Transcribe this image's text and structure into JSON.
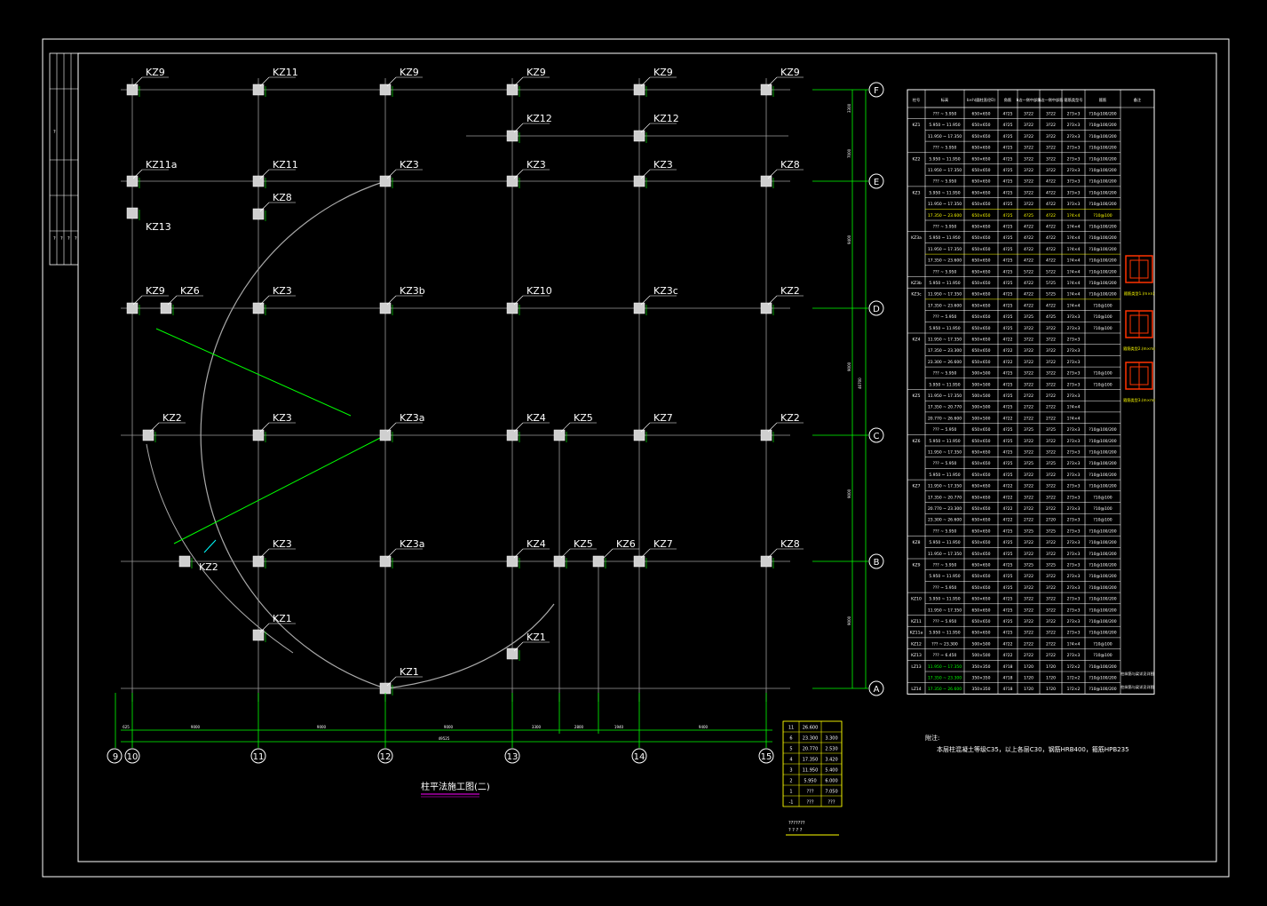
{
  "drawing": {
    "title": "柱平法施工图(二)",
    "notes_title": "附注:",
    "notes_text": "本层柱混凝土等级C35，以上各层C30，钢筋HRB400，箍筋HPB235",
    "bottom_total": "49525",
    "bottom_dims": [
      "625",
      "9000",
      "9000",
      "9000",
      "3300",
      "2800",
      "1940",
      "9400"
    ],
    "right_total": "46700",
    "right_dims": [
      "3300",
      "7000",
      "9400",
      "9000",
      "9000",
      "9000"
    ]
  },
  "grid": {
    "x_axes": [
      "9",
      "10",
      "11",
      "12",
      "13",
      "14",
      "15"
    ],
    "y_axes": [
      "F",
      "E",
      "D",
      "C",
      "B",
      "A"
    ]
  },
  "column_labels": [
    {
      "id": "r1c1",
      "text": "KZ9"
    },
    {
      "id": "r1c2",
      "text": "KZ11"
    },
    {
      "id": "r1c3",
      "text": "KZ9"
    },
    {
      "id": "r1c4",
      "text": "KZ9"
    },
    {
      "id": "r1c5",
      "text": "KZ9"
    },
    {
      "id": "r1c6",
      "text": "KZ9"
    },
    {
      "id": "r1b4",
      "text": "KZ12"
    },
    {
      "id": "r1b5",
      "text": "KZ12"
    },
    {
      "id": "r2c1",
      "text": "KZ11a"
    },
    {
      "id": "r2c2",
      "text": "KZ11"
    },
    {
      "id": "r2c3",
      "text": "KZ3"
    },
    {
      "id": "r2c4",
      "text": "KZ3"
    },
    {
      "id": "r2c5",
      "text": "KZ3"
    },
    {
      "id": "r2c6",
      "text": "KZ8"
    },
    {
      "id": "r2b2",
      "text": "KZ8"
    },
    {
      "id": "r2b1",
      "text": "KZ13"
    },
    {
      "id": "r3c1",
      "text": "KZ9"
    },
    {
      "id": "r3c1b",
      "text": "KZ6"
    },
    {
      "id": "r3c2",
      "text": "KZ3"
    },
    {
      "id": "r3c3",
      "text": "KZ3b"
    },
    {
      "id": "r3c4",
      "text": "KZ10"
    },
    {
      "id": "r3c5",
      "text": "KZ3c"
    },
    {
      "id": "r3c6",
      "text": "KZ2"
    },
    {
      "id": "r4c1",
      "text": "KZ2"
    },
    {
      "id": "r4c2",
      "text": "KZ3"
    },
    {
      "id": "r4c3",
      "text": "KZ3a"
    },
    {
      "id": "r4c4",
      "text": "KZ4"
    },
    {
      "id": "r4c4b",
      "text": "KZ5"
    },
    {
      "id": "r4c5",
      "text": "KZ7"
    },
    {
      "id": "r4c6",
      "text": "KZ2"
    },
    {
      "id": "r5c1",
      "text": "KZ2"
    },
    {
      "id": "r5c2",
      "text": "KZ3"
    },
    {
      "id": "r5c3",
      "text": "KZ3a"
    },
    {
      "id": "r5c4",
      "text": "KZ4"
    },
    {
      "id": "r5c4b",
      "text": "KZ5"
    },
    {
      "id": "r5c4c",
      "text": "KZ6"
    },
    {
      "id": "r5c5",
      "text": "KZ7"
    },
    {
      "id": "r5c6",
      "text": "KZ8"
    },
    {
      "id": "r5b2",
      "text": "KZ1"
    },
    {
      "id": "r5b4",
      "text": "KZ1"
    },
    {
      "id": "r6c3",
      "text": "KZ1"
    }
  ],
  "schedule": {
    "headers": [
      "柱号",
      "标高",
      "b×h(圆柱直径D)",
      "角筋",
      "b边一侧中部筋",
      "h边一侧中部筋",
      "箍筋类型号",
      "箍筋",
      "备注"
    ],
    "rows": [
      [
        "",
        "??? ~ 5.950",
        "650×650",
        "4?25",
        "3?22",
        "3?22",
        "2?3×3",
        "?10@100/200"
      ],
      [
        "KZ1",
        "5.950 ~ 11.950",
        "650×650",
        "4?25",
        "3?22",
        "3?22",
        "2?3×3",
        "?10@100/200"
      ],
      [
        "",
        "11.950 ~ 17.350",
        "650×650",
        "4?25",
        "3?22",
        "3?22",
        "2?3×3",
        "?10@100/200"
      ],
      [
        "",
        "??? ~ 5.950",
        "650×650",
        "4?25",
        "3?22",
        "3?22",
        "2?3×3",
        "?10@100/200"
      ],
      [
        "KZ2",
        "5.950 ~ 11.950",
        "650×650",
        "4?25",
        "3?22",
        "3?22",
        "2?3×3",
        "?10@100/200"
      ],
      [
        "",
        "11.950 ~ 17.350",
        "650×650",
        "4?25",
        "3?22",
        "3?22",
        "2?3×3",
        "?10@100/200"
      ],
      [
        "",
        "??? ~ 5.950",
        "650×650",
        "4?25",
        "3?22",
        "4?22",
        "3?3×3",
        "?10@100/200"
      ],
      [
        "KZ3",
        "5.950 ~ 11.950",
        "650×650",
        "4?25",
        "3?22",
        "4?22",
        "3?3×3",
        "?10@100/200"
      ],
      [
        "",
        "11.950 ~ 17.350",
        "650×650",
        "4?25",
        "3?22",
        "4?22",
        "3?3×3",
        "?10@100/200"
      ],
      [
        "",
        "17.350 ~ 23.600",
        "650×650",
        "4?25",
        "4?25",
        "4?22",
        "1?4×4",
        "?10@100"
      ],
      [
        "",
        "??? ~ 5.950",
        "650×650",
        "4?25",
        "4?22",
        "4?22",
        "1?4×4",
        "?10@100/200"
      ],
      [
        "KZ3a",
        "5.950 ~ 11.950",
        "650×650",
        "4?25",
        "4?22",
        "4?22",
        "1?4×4",
        "?10@100/200"
      ],
      [
        "",
        "11.950 ~ 17.350",
        "650×650",
        "4?25",
        "4?22",
        "4?22",
        "1?4×4",
        "?10@100/200"
      ],
      [
        "",
        "17.350 ~ 23.600",
        "650×650",
        "4?25",
        "4?22",
        "4?22",
        "1?4×4",
        "?10@100/200"
      ],
      [
        "",
        "??? ~ 5.950",
        "650×650",
        "4?25",
        "5?22",
        "5?22",
        "1?4×4",
        "?10@100/200"
      ],
      [
        "KZ3b",
        "5.950 ~ 11.950",
        "650×650",
        "4?25",
        "4?22",
        "5?25",
        "1?4×4",
        "?10@100/200"
      ],
      [
        "KZ3c",
        "11.950 ~ 17.350",
        "650×650",
        "4?25",
        "4?22",
        "5?25",
        "1?4×4",
        "?10@100/200"
      ],
      [
        "",
        "17.350 ~ 23.600",
        "650×650",
        "4?25",
        "4?22",
        "4?22",
        "1?4×4",
        "?10@100"
      ],
      [
        "",
        "??? ~ 5.950",
        "650×650",
        "4?25",
        "3?25",
        "4?25",
        "3?3×3",
        "?10@100"
      ],
      [
        "",
        "5.950 ~ 11.950",
        "650×650",
        "4?25",
        "3?22",
        "3?22",
        "2?3×3",
        "?10@100"
      ],
      [
        "KZ4",
        "11.950 ~ 17.350",
        "650×650",
        "4?22",
        "3?22",
        "3?22",
        "2?3×3",
        ""
      ],
      [
        "",
        "17.350 ~ 23.300",
        "650×650",
        "4?22",
        "3?22",
        "3?22",
        "2?3×3",
        ""
      ],
      [
        "",
        "23.300 ~ 26.600",
        "650×650",
        "4?22",
        "3?22",
        "3?22",
        "2?3×3",
        ""
      ],
      [
        "",
        "??? ~ 5.950",
        "500×500",
        "4?25",
        "3?22",
        "3?22",
        "2?3×3",
        "?10@100"
      ],
      [
        "",
        "5.950 ~ 11.950",
        "500×500",
        "4?25",
        "3?22",
        "3?22",
        "2?3×3",
        "?10@100"
      ],
      [
        "KZ5",
        "11.950 ~ 17.350",
        "500×500",
        "4?25",
        "2?22",
        "2?22",
        "2?3×3",
        ""
      ],
      [
        "",
        "17.350 ~ 20.770",
        "500×500",
        "4?25",
        "2?22",
        "2?22",
        "1?4×4",
        ""
      ],
      [
        "",
        "20.770 ~ 26.600",
        "500×500",
        "4?22",
        "2?22",
        "2?22",
        "1?4×4",
        ""
      ],
      [
        "",
        "??? ~ 5.950",
        "650×650",
        "4?25",
        "3?25",
        "3?25",
        "2?3×3",
        "?10@100/200"
      ],
      [
        "KZ6",
        "5.950 ~ 11.950",
        "650×650",
        "4?25",
        "3?22",
        "3?22",
        "2?3×3",
        "?10@100/200"
      ],
      [
        "",
        "11.950 ~ 17.350",
        "650×650",
        "4?25",
        "3?22",
        "3?22",
        "2?3×3",
        "?10@100/200"
      ],
      [
        "",
        "??? ~ 5.950",
        "650×650",
        "4?25",
        "3?25",
        "3?25",
        "2?3×3",
        "?10@100/200"
      ],
      [
        "",
        "5.950 ~ 11.950",
        "650×650",
        "4?25",
        "3?22",
        "3?22",
        "2?3×3",
        "?10@100/200"
      ],
      [
        "KZ7",
        "11.950 ~ 17.350",
        "650×650",
        "4?22",
        "3?22",
        "3?22",
        "2?3×3",
        "?10@100/200"
      ],
      [
        "",
        "17.350 ~ 20.770",
        "650×650",
        "4?22",
        "3?22",
        "3?22",
        "2?3×3",
        "?10@100"
      ],
      [
        "",
        "20.770 ~ 23.300",
        "650×650",
        "4?22",
        "2?22",
        "2?22",
        "2?3×3",
        "?10@100"
      ],
      [
        "",
        "23.300 ~ 26.600",
        "650×650",
        "4?22",
        "2?22",
        "2?20",
        "2?3×3",
        "?10@100"
      ],
      [
        "",
        "??? ~ 5.950",
        "650×650",
        "4?25",
        "3?25",
        "3?25",
        "2?3×3",
        "?10@100/200"
      ],
      [
        "KZ8",
        "5.950 ~ 11.950",
        "650×650",
        "4?25",
        "3?22",
        "3?22",
        "2?3×3",
        "?10@100/200"
      ],
      [
        "",
        "11.950 ~ 17.350",
        "650×650",
        "4?25",
        "3?22",
        "3?22",
        "2?3×3",
        "?10@100/200"
      ],
      [
        "KZ9",
        "??? ~ 5.950",
        "650×650",
        "4?25",
        "3?25",
        "3?25",
        "2?3×3",
        "?10@100/200"
      ],
      [
        "",
        "5.950 ~ 11.950",
        "650×650",
        "4?25",
        "3?22",
        "3?22",
        "2?3×3",
        "?10@100/200"
      ],
      [
        "",
        "??? ~ 5.950",
        "650×650",
        "4?25",
        "3?22",
        "3?22",
        "2?3×3",
        "?10@100/200"
      ],
      [
        "KZ10",
        "5.950 ~ 11.950",
        "650×650",
        "4?25",
        "3?22",
        "3?22",
        "2?3×3",
        "?10@100/200"
      ],
      [
        "",
        "11.950 ~ 17.350",
        "650×650",
        "4?25",
        "3?22",
        "3?22",
        "2?3×3",
        "?10@100/200"
      ],
      [
        "KZ11",
        "??? ~ 5.950",
        "650×650",
        "4?25",
        "3?22",
        "3?22",
        "2?3×3",
        "?10@100/200"
      ],
      [
        "KZ11a",
        "5.950 ~ 11.950",
        "650×650",
        "4?25",
        "3?22",
        "3?22",
        "2?3×3",
        "?10@100/200"
      ],
      [
        "KZ12",
        "??? ~ 23.300",
        "500×500",
        "4?22",
        "2?22",
        "2?22",
        "1?4×4",
        "?10@100"
      ],
      [
        "KZ13",
        "??? ~ 6.450",
        "500×500",
        "4?22",
        "2?22",
        "2?22",
        "2?3×3",
        "?10@100"
      ],
      [
        "LZ13",
        "11.950 ~ 17.350",
        "350×350",
        "4?18",
        "1?20",
        "1?20",
        "1?2×2",
        "?10@100/200"
      ],
      [
        "",
        "17.350 ~ 23.300",
        "350×350",
        "4?18",
        "1?20",
        "1?20",
        "1?2×2",
        "?10@100/200"
      ],
      [
        "LZ14",
        "17.350 ~ 26.600",
        "350×350",
        "4?18",
        "1?20",
        "1?20",
        "1?2×2",
        "?10@100/200"
      ]
    ],
    "remarks": [
      "柱纵筋与梁详见详图",
      "柱纵筋与梁详见详图"
    ],
    "section_labels": [
      "箍筋类型1.(m×n)",
      "箍筋类型2.(m×m)",
      "箍筋类型3.(m×m)"
    ]
  },
  "levels": {
    "rows": [
      [
        "11",
        "26.600",
        ""
      ],
      [
        "6",
        "23.300",
        "3.300"
      ],
      [
        "5",
        "20.770",
        "2.530"
      ],
      [
        "4",
        "17.350",
        "3.420"
      ],
      [
        "3",
        "11.950",
        "5.400"
      ],
      [
        "2",
        "5.950",
        "6.000"
      ],
      [
        "1",
        "???",
        "7.050"
      ],
      [
        "-1",
        "???",
        "???"
      ]
    ],
    "footer1": "???????",
    "footer2": "?  ?  ?  ?"
  },
  "title_block_left": [
    "?",
    "?",
    "?",
    "?",
    "?"
  ],
  "colors": {
    "background": "#000000",
    "frame": "#ffffff",
    "grid": "#9a9a9a",
    "dimension": "#00ff00",
    "text": "#ffffff",
    "highlight": "#ffff00",
    "arc": "#aaaaaa",
    "title_underline": "#ff00ff",
    "section_red": "#ff3300"
  }
}
